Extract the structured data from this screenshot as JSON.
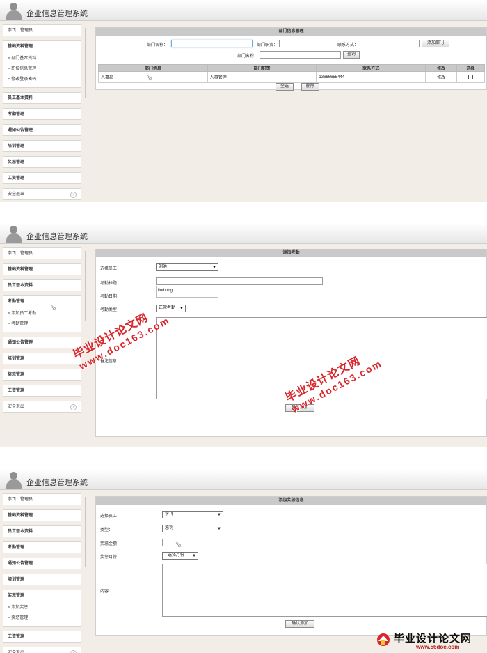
{
  "app": {
    "title": "企业信息管理系统"
  },
  "user_label": "李飞：管理员",
  "exit_label": "安全退出",
  "shot1": {
    "sidebar": {
      "open_group": "基础资料管理",
      "sub_items": [
        "部门基本资料",
        "职位信息管理",
        "修改登录密码"
      ],
      "groups": [
        "员工基本资料",
        "考勤管理",
        "通知公告管理",
        "培训管理",
        "奖惩管理",
        "工资管理"
      ]
    },
    "panel": {
      "title": "部门信息管理",
      "dept_name_label": "部门名称：",
      "dept_duty_label": "部门职责：",
      "contact_label": "联系方式：",
      "add_button": "添加部门",
      "search_name_label": "部门名称：",
      "search_button": "查询",
      "table": {
        "headers": [
          "部门信息",
          "部门职责",
          "联系方式",
          "修改",
          "选择"
        ],
        "rows": [
          {
            "name": "人事部",
            "duty": "人事管理",
            "contact": "13666655444",
            "edit": "修改"
          }
        ]
      },
      "select_all_button": "全选",
      "delete_button": "删除"
    }
  },
  "shot2": {
    "sidebar": {
      "groups_before": [
        "基础资料管理",
        "员工基本资料"
      ],
      "open_group": "考勤管理",
      "sub_items": [
        "添加员工考勤",
        "考勤管理"
      ],
      "groups_after": [
        "通知公告管理",
        "培训管理",
        "奖惩管理",
        "工资管理"
      ]
    },
    "panel": {
      "title": "添加考勤",
      "employee_label": "选择员工",
      "employee_value": "刘洪",
      "title_label": "考勤标题：",
      "date_label": "考勤日期",
      "autocomplete_value": "liu/hongi",
      "type_label": "考勤类型",
      "type_value": "正常考勤",
      "remark_label": "备注信息：",
      "confirm_button": "确认添加"
    }
  },
  "shot3": {
    "sidebar": {
      "groups_before": [
        "基础资料管理",
        "员工基本资料",
        "考勤管理",
        "通知公告管理",
        "培训管理"
      ],
      "open_group": "奖惩管理",
      "sub_items": [
        "添加奖惩",
        "奖惩管理"
      ],
      "groups_after": [
        "工资管理"
      ]
    },
    "panel": {
      "title": "添加奖惩信息",
      "employee_label": "选择员工：",
      "employee_value": "李飞",
      "type_label": "类型：",
      "type_value": "惩罚",
      "amount_label": "奖惩金额：",
      "month_label": "奖惩月份：",
      "month_value": "--选择月份--",
      "content_label": "内容：",
      "confirm_button": "确认添加"
    }
  },
  "watermarks": {
    "site_name": "毕业设计论文网",
    "url": "www.doc163.com"
  },
  "footer_logo": {
    "text": "毕业设计论文网",
    "url": "www.56doc.com"
  },
  "colors": {
    "watermark": "#d8262b",
    "header_bar": "#c9c9c9",
    "canvas": "#f3ede7"
  }
}
